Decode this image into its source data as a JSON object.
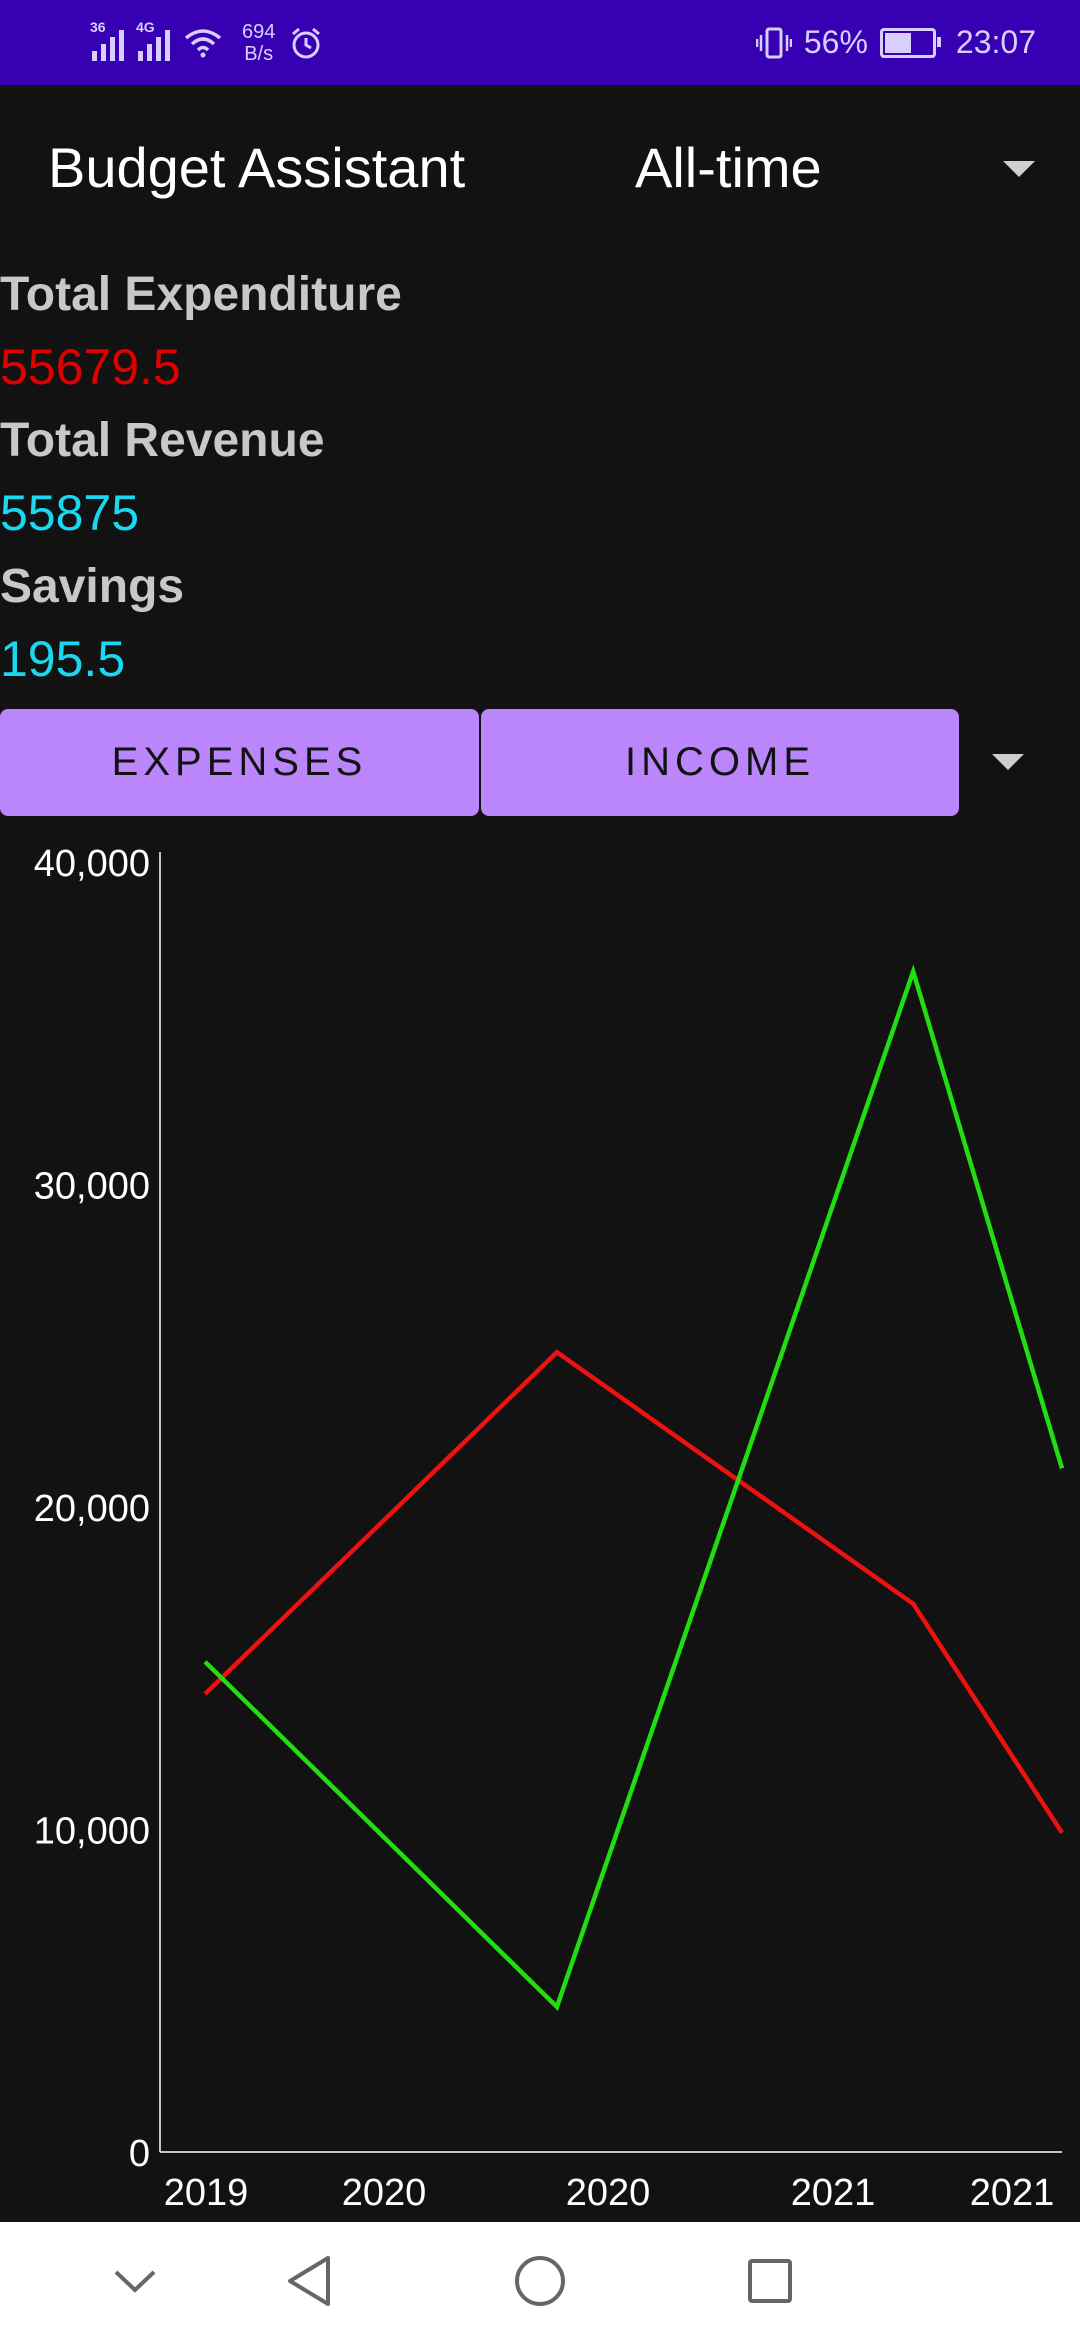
{
  "status_bar": {
    "signal1_tag": "36",
    "signal2_tag": "4G",
    "net_speed_value": "694",
    "net_speed_unit": "B/s",
    "battery_pct": "56%",
    "time": "23:07"
  },
  "app_bar": {
    "title": "Budget Assistant",
    "period": "All-time"
  },
  "summary": {
    "expenditure_label": "Total Expenditure",
    "expenditure_value": "55679.5",
    "revenue_label": "Total Revenue",
    "revenue_value": "55875",
    "savings_label": "Savings",
    "savings_value": "195.5"
  },
  "toggles": {
    "expenses_label": "EXPENSES",
    "income_label": "INCOME"
  },
  "colors": {
    "accent": "#bb86fc",
    "expense": "#e00000",
    "revenue": "#19d8f0",
    "expense_line": "#ee1111",
    "income_line": "#22dd11"
  },
  "chart_data": {
    "type": "line",
    "y_ticks": [
      "40,000",
      "30,000",
      "20,000",
      "10,000",
      "0"
    ],
    "x_tick_labels": [
      "2019",
      "2020",
      "2020",
      "2021",
      "2021"
    ],
    "ylim": [
      0,
      40000
    ],
    "series": [
      {
        "color": "#ee1111",
        "points": [
          [
            0.05,
            14200
          ],
          [
            0.44,
            24800
          ],
          [
            0.835,
            17000
          ],
          [
            1.0,
            9900
          ]
        ]
      },
      {
        "color": "#22dd11",
        "points": [
          [
            0.05,
            15200
          ],
          [
            0.44,
            4500
          ],
          [
            0.835,
            36600
          ],
          [
            1.0,
            21200
          ]
        ]
      }
    ]
  },
  "nav_bar": {
    "icons": [
      "chevron-down-icon",
      "back-icon",
      "home-icon",
      "recents-icon"
    ]
  }
}
